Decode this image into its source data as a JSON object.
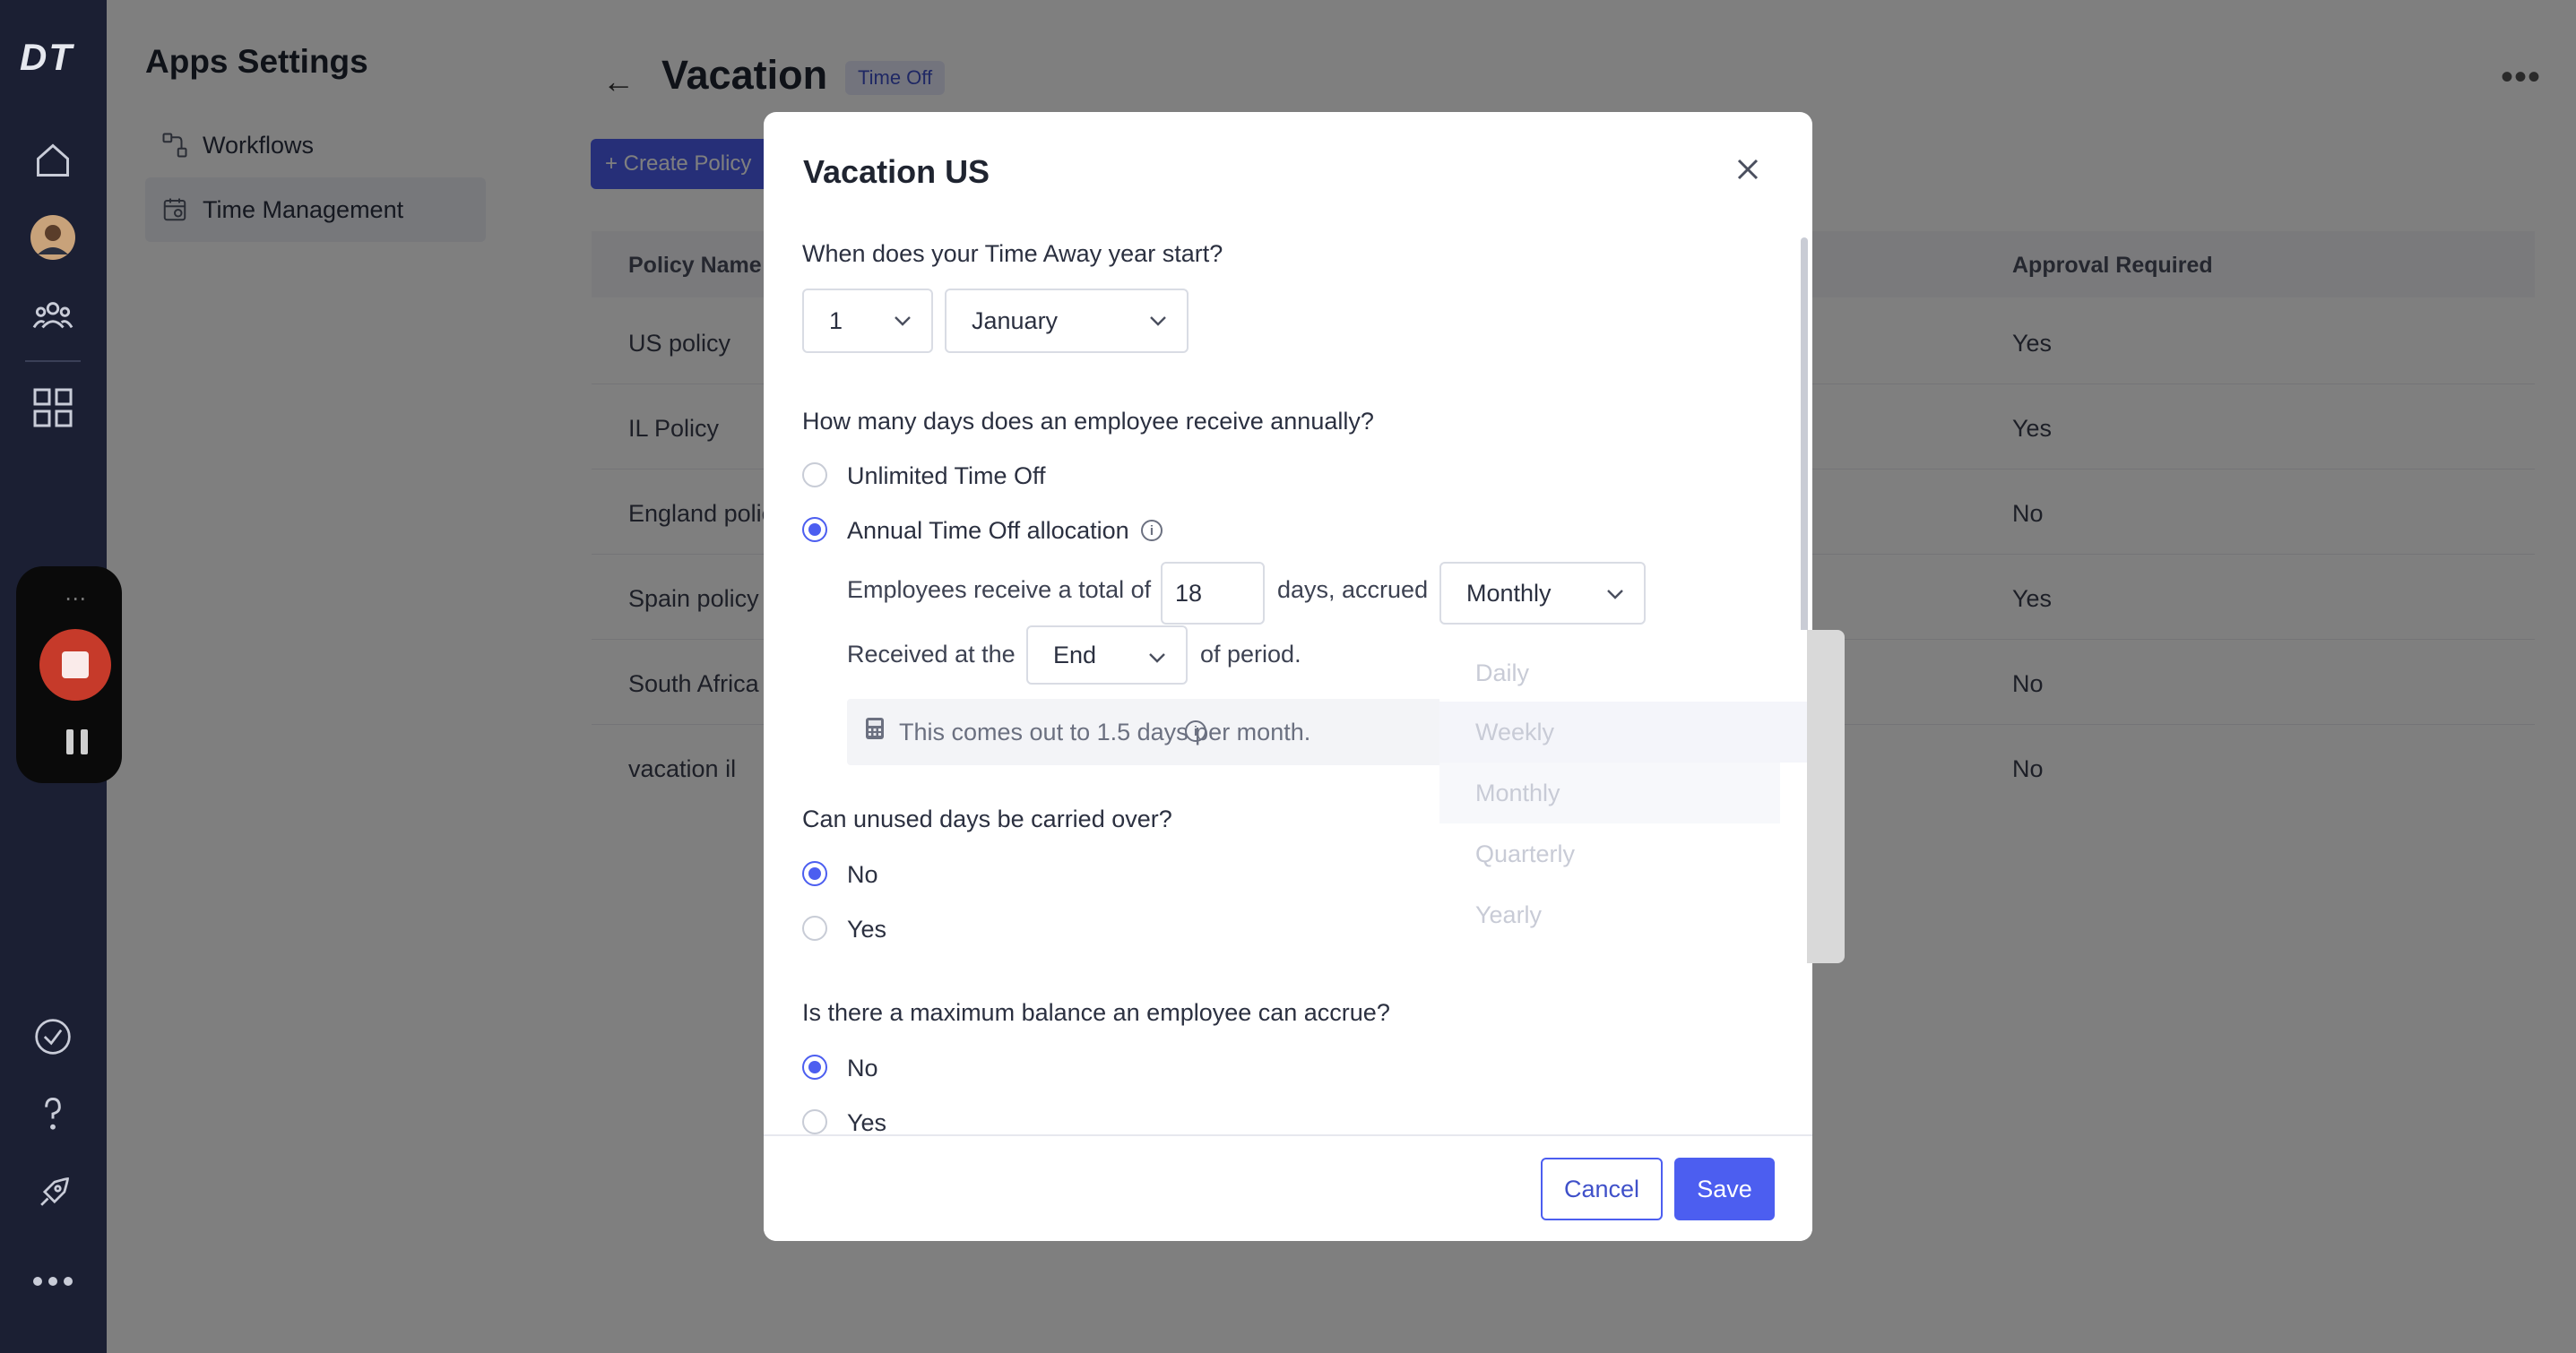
{
  "rail": {
    "logo": "DT",
    "icons": [
      "home-icon",
      "avatar",
      "people-icon",
      "apps-grid-icon",
      "check-circle-icon",
      "help-icon",
      "rocket-icon",
      "more-icon"
    ]
  },
  "sidebar": {
    "title": "Apps Settings",
    "items": [
      {
        "label": "Workflows",
        "active": false
      },
      {
        "label": "Time Management",
        "active": true
      }
    ]
  },
  "page": {
    "title": "Vacation",
    "tag": "Time Off",
    "create_button": "+ Create Policy",
    "table": {
      "headers": [
        "Policy Name",
        "Approval Required"
      ],
      "rows": [
        {
          "name": "US policy",
          "approval": "Yes"
        },
        {
          "name": "IL Policy",
          "approval": "Yes"
        },
        {
          "name": "England polic",
          "approval": "No"
        },
        {
          "name": "Spain policy",
          "approval": "Yes"
        },
        {
          "name": "South Africa",
          "approval": "No"
        },
        {
          "name": "vacation il",
          "approval": "No"
        }
      ]
    }
  },
  "modal": {
    "title": "Vacation US",
    "q1": "When does your Time Away year start?",
    "day_value": "1",
    "month_value": "January",
    "q2": "How many days does an employee receive annually?",
    "opt_unlimited": "Unlimited Time Off",
    "opt_annual": "Annual Time Off allocation",
    "receive_prefix": "Employees receive a total of",
    "days_value": "18",
    "receive_suffix": "days, accrued",
    "accrual_value": "Monthly",
    "received_prefix": "Received at the",
    "received_value": "End",
    "received_suffix": "of period.",
    "info_text": "This comes out to 1.5 days per month.",
    "q3": "Can unused days be carried over?",
    "carry_no": "No",
    "carry_yes": "Yes",
    "q4": "Is there a maximum balance an employee can accrue?",
    "max_no": "No",
    "max_yes": "Yes",
    "cancel": "Cancel",
    "save": "Save"
  },
  "dropdown": {
    "options": [
      "Daily",
      "Weekly",
      "Monthly",
      "Quarterly",
      "Yearly"
    ],
    "selected": "Monthly"
  },
  "colors": {
    "accent": "#4c5ef0",
    "rail": "#1b1f33",
    "record": "#c63a2a"
  }
}
